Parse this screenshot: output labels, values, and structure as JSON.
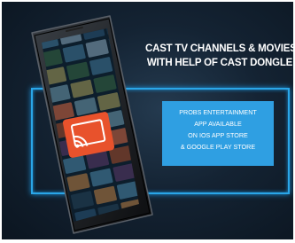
{
  "headline": {
    "line1": "CAST TV CHANNELS & MOVIES",
    "line2": "WITH HELP OF CAST DONGLE"
  },
  "promo": {
    "line1": "PROBS ENTERTAINMENT",
    "line2": "APP AVAILABLE",
    "line3": "ON IOS APP STORE",
    "line4": "& GOOGLE PLAY STORE"
  },
  "colors": {
    "background": "#142333",
    "accent_blue": "#2f9fe2",
    "cast_orange": "#e8522c"
  },
  "icons": {
    "cast": "cast-icon"
  }
}
